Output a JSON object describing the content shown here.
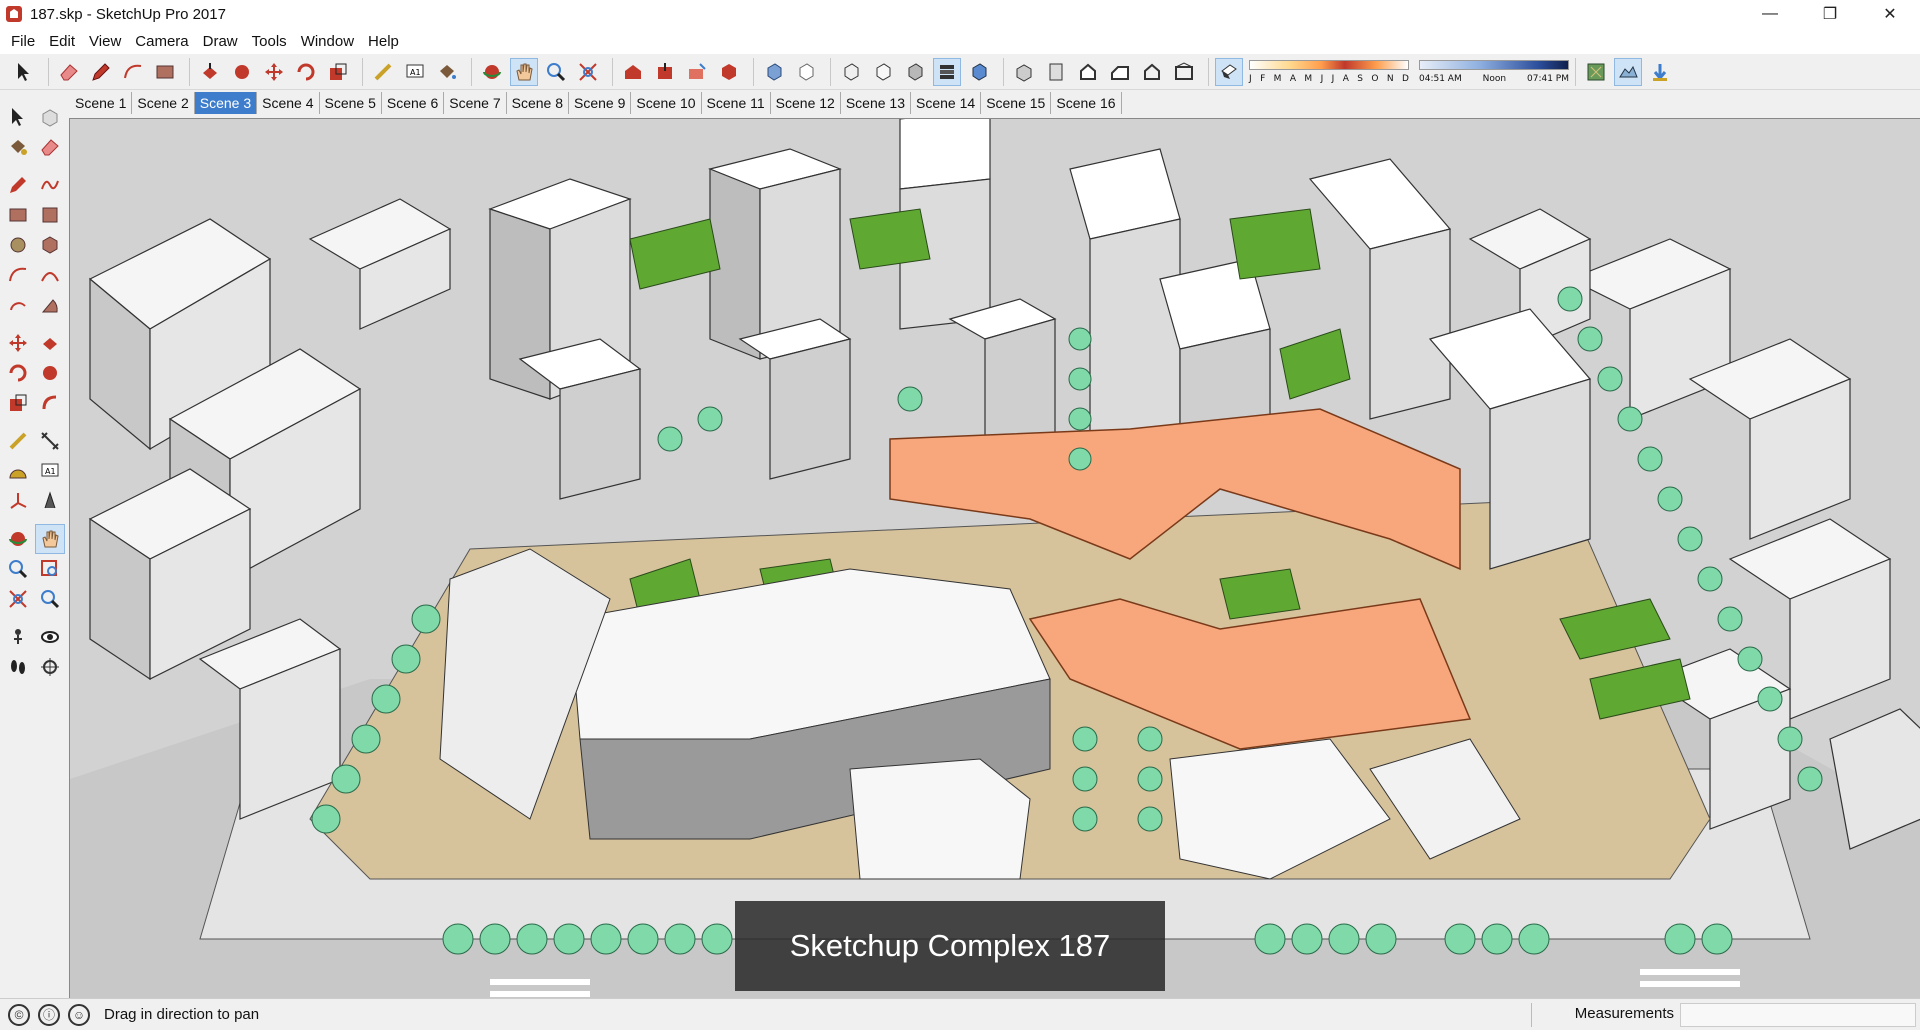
{
  "window": {
    "title": "187.skp - SketchUp Pro 2017",
    "minimize": "—",
    "restore": "❐",
    "close": "✕"
  },
  "menu": [
    "File",
    "Edit",
    "View",
    "Camera",
    "Draw",
    "Tools",
    "Window",
    "Help"
  ],
  "shadow": {
    "months": [
      "J",
      "F",
      "M",
      "A",
      "M",
      "J",
      "J",
      "A",
      "S",
      "O",
      "N",
      "D"
    ],
    "time_start": "04:51 AM",
    "time_mid": "Noon",
    "time_end": "07:41 PM"
  },
  "scenes": {
    "tabs": [
      "Scene 1",
      "Scene 2",
      "Scene 3",
      "Scene 4",
      "Scene 5",
      "Scene 6",
      "Scene 7",
      "Scene 8",
      "Scene 9",
      "Scene 10",
      "Scene 11",
      "Scene 12",
      "Scene 13",
      "Scene 14",
      "Scene 15",
      "Scene 16"
    ],
    "active_index": 2
  },
  "viewport": {
    "caption": "Sketchup Complex 187"
  },
  "status": {
    "hint": "Drag in direction to pan",
    "measurements_label": "Measurements",
    "measurements_value": ""
  },
  "colors": {
    "accent": "#3d7dcc",
    "roof_orange": "#f7a77b",
    "grass": "#5fa832",
    "tree": "#7fd9a8",
    "ground": "#d6c29b"
  }
}
